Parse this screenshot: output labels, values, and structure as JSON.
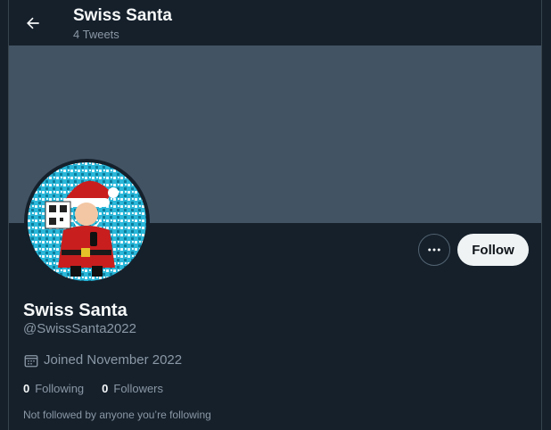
{
  "header": {
    "title": "Swiss Santa",
    "tweet_count": "4 Tweets"
  },
  "profile": {
    "name": "Swiss Santa",
    "handle": "@SwissSanta2022",
    "joined": "Joined November 2022",
    "following_count": "0",
    "following_label": "Following",
    "followers_count": "0",
    "followers_label": "Followers",
    "not_followed": "Not followed by anyone you’re following"
  },
  "actions": {
    "follow_label": "Follow"
  },
  "icons": {
    "back": "arrow-left-icon",
    "more": "more-horizontal-icon",
    "calendar": "calendar-icon"
  },
  "colors": {
    "background": "#15202b",
    "banner": "#425364",
    "secondary_text": "#8b98a5",
    "follow_button": "#eff3f4"
  }
}
